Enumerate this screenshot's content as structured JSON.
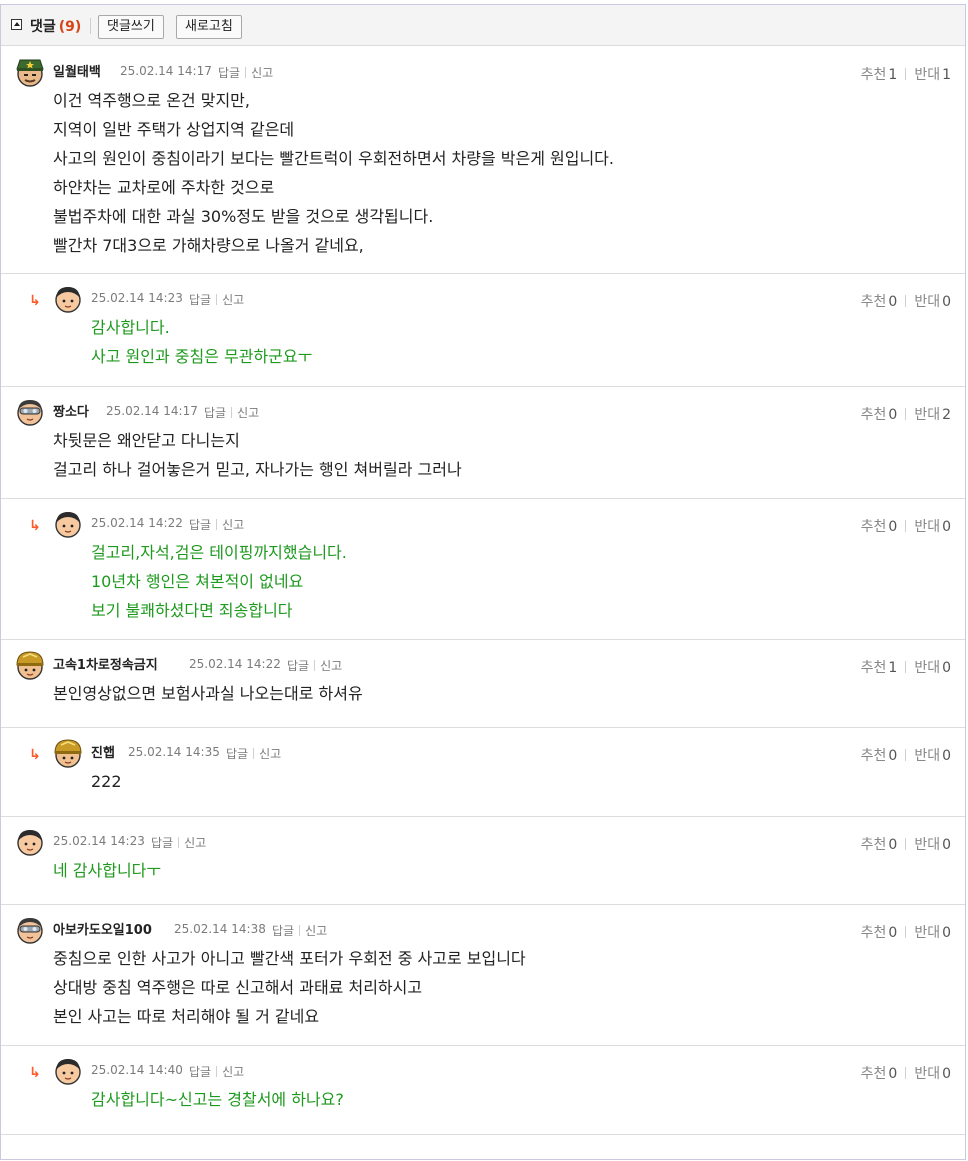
{
  "header": {
    "title": "댓글",
    "count": "(9)",
    "write_button": "댓글쓰기",
    "refresh_button": "새로고침"
  },
  "labels": {
    "reply": "답글",
    "report": "신고",
    "like": "추천",
    "dislike": "반대"
  },
  "colors": {
    "reply_text": "#1e9a1e",
    "count": "#d84315",
    "reply_arrow": "#ff5a2a"
  },
  "comments": [
    {
      "nick": "일월태백",
      "date": "25.02.14 14:17",
      "likes": "1",
      "dislikes": "1",
      "avatar": "soldier-avatar",
      "lines": [
        "이건 역주행으로 온건 맞지만,",
        "지역이 일반 주택가 상업지역 같은데",
        "사고의 원인이 중침이라기 보다는 빨간트럭이 우회전하면서 차량을 박은게 원입니다.",
        "하얀차는 교차로에 주차한 것으로",
        "불법주차에 대한 과실 30%정도 받을 것으로 생각됩니다.",
        "빨간차 7대3으로 가해차량으로 나올거 같네요,"
      ]
    },
    {
      "reply": true,
      "nick": "",
      "date": "25.02.14 14:23",
      "likes": "0",
      "dislikes": "0",
      "avatar": "face-avatar",
      "green": true,
      "lines": [
        "감사합니다.",
        "사고 원인과 중침은 무관하군요ㅜ"
      ]
    },
    {
      "nick": "짱소다",
      "date": "25.02.14 14:17",
      "likes": "0",
      "dislikes": "2",
      "avatar": "goggles-avatar",
      "lines": [
        "차뒷문은 왜안닫고 다니는지",
        "걸고리 하나 걸어놓은거 믿고, 자나가는 행인 쳐버릴라 그러나"
      ]
    },
    {
      "reply": true,
      "nick": "",
      "date": "25.02.14 14:22",
      "likes": "0",
      "dislikes": "0",
      "avatar": "face-avatar",
      "green": true,
      "lines": [
        "걸고리,자석,검은 테이핑까지했습니다.",
        "10년차 행인은 쳐본적이 없네요",
        "보기 불쾌하셨다면 죄송합니다"
      ]
    },
    {
      "nick": "고속1차로정속금지",
      "date": "25.02.14 14:22",
      "likes": "1",
      "dislikes": "0",
      "avatar": "helmet-avatar",
      "lines": [
        "본인영상없으면 보험사과실 나오는대로 하셔유"
      ]
    },
    {
      "reply": true,
      "nick": "진햅",
      "date": "25.02.14 14:35",
      "likes": "0",
      "dislikes": "0",
      "avatar": "helmet-avatar",
      "lines": [
        "222"
      ]
    },
    {
      "nick": "",
      "date": "25.02.14 14:23",
      "likes": "0",
      "dislikes": "0",
      "avatar": "face-avatar",
      "green": true,
      "lines": [
        "네 감사합니다ㅜ"
      ]
    },
    {
      "nick": "아보카도오일100",
      "date": "25.02.14 14:38",
      "likes": "0",
      "dislikes": "0",
      "avatar": "goggles-avatar",
      "lines": [
        "중침으로 인한 사고가 아니고 빨간색 포터가 우회전 중 사고로 보입니다",
        "상대방 중침 역주행은 따로 신고해서 과태료 처리하시고",
        "본인 사고는 따로 처리해야 될 거 같네요"
      ]
    },
    {
      "reply": true,
      "nick": "",
      "date": "25.02.14 14:40",
      "likes": "0",
      "dislikes": "0",
      "avatar": "face-avatar",
      "green": true,
      "lines": [
        "감사합니다~신고는 경찰서에 하나요?"
      ]
    }
  ]
}
